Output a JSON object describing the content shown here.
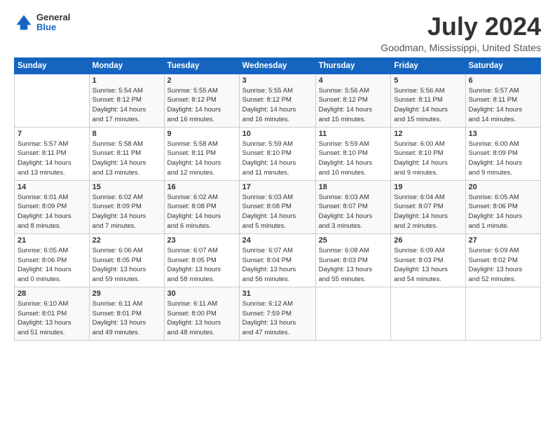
{
  "header": {
    "logo": {
      "general": "General",
      "blue": "Blue"
    },
    "title": "July 2024",
    "location": "Goodman, Mississippi, United States"
  },
  "weekdays": [
    "Sunday",
    "Monday",
    "Tuesday",
    "Wednesday",
    "Thursday",
    "Friday",
    "Saturday"
  ],
  "weeks": [
    [
      {
        "day": "",
        "info": ""
      },
      {
        "day": "1",
        "info": "Sunrise: 5:54 AM\nSunset: 8:12 PM\nDaylight: 14 hours\nand 17 minutes."
      },
      {
        "day": "2",
        "info": "Sunrise: 5:55 AM\nSunset: 8:12 PM\nDaylight: 14 hours\nand 16 minutes."
      },
      {
        "day": "3",
        "info": "Sunrise: 5:55 AM\nSunset: 8:12 PM\nDaylight: 14 hours\nand 16 minutes."
      },
      {
        "day": "4",
        "info": "Sunrise: 5:56 AM\nSunset: 8:12 PM\nDaylight: 14 hours\nand 15 minutes."
      },
      {
        "day": "5",
        "info": "Sunrise: 5:56 AM\nSunset: 8:11 PM\nDaylight: 14 hours\nand 15 minutes."
      },
      {
        "day": "6",
        "info": "Sunrise: 5:57 AM\nSunset: 8:11 PM\nDaylight: 14 hours\nand 14 minutes."
      }
    ],
    [
      {
        "day": "7",
        "info": "Sunrise: 5:57 AM\nSunset: 8:11 PM\nDaylight: 14 hours\nand 13 minutes."
      },
      {
        "day": "8",
        "info": "Sunrise: 5:58 AM\nSunset: 8:11 PM\nDaylight: 14 hours\nand 13 minutes."
      },
      {
        "day": "9",
        "info": "Sunrise: 5:58 AM\nSunset: 8:11 PM\nDaylight: 14 hours\nand 12 minutes."
      },
      {
        "day": "10",
        "info": "Sunrise: 5:59 AM\nSunset: 8:10 PM\nDaylight: 14 hours\nand 11 minutes."
      },
      {
        "day": "11",
        "info": "Sunrise: 5:59 AM\nSunset: 8:10 PM\nDaylight: 14 hours\nand 10 minutes."
      },
      {
        "day": "12",
        "info": "Sunrise: 6:00 AM\nSunset: 8:10 PM\nDaylight: 14 hours\nand 9 minutes."
      },
      {
        "day": "13",
        "info": "Sunrise: 6:00 AM\nSunset: 8:09 PM\nDaylight: 14 hours\nand 9 minutes."
      }
    ],
    [
      {
        "day": "14",
        "info": "Sunrise: 6:01 AM\nSunset: 8:09 PM\nDaylight: 14 hours\nand 8 minutes."
      },
      {
        "day": "15",
        "info": "Sunrise: 6:02 AM\nSunset: 8:09 PM\nDaylight: 14 hours\nand 7 minutes."
      },
      {
        "day": "16",
        "info": "Sunrise: 6:02 AM\nSunset: 8:08 PM\nDaylight: 14 hours\nand 6 minutes."
      },
      {
        "day": "17",
        "info": "Sunrise: 6:03 AM\nSunset: 8:08 PM\nDaylight: 14 hours\nand 5 minutes."
      },
      {
        "day": "18",
        "info": "Sunrise: 6:03 AM\nSunset: 8:07 PM\nDaylight: 14 hours\nand 3 minutes."
      },
      {
        "day": "19",
        "info": "Sunrise: 6:04 AM\nSunset: 8:07 PM\nDaylight: 14 hours\nand 2 minutes."
      },
      {
        "day": "20",
        "info": "Sunrise: 6:05 AM\nSunset: 8:06 PM\nDaylight: 14 hours\nand 1 minute."
      }
    ],
    [
      {
        "day": "21",
        "info": "Sunrise: 6:05 AM\nSunset: 8:06 PM\nDaylight: 14 hours\nand 0 minutes."
      },
      {
        "day": "22",
        "info": "Sunrise: 6:06 AM\nSunset: 8:05 PM\nDaylight: 13 hours\nand 59 minutes."
      },
      {
        "day": "23",
        "info": "Sunrise: 6:07 AM\nSunset: 8:05 PM\nDaylight: 13 hours\nand 58 minutes."
      },
      {
        "day": "24",
        "info": "Sunrise: 6:07 AM\nSunset: 8:04 PM\nDaylight: 13 hours\nand 56 minutes."
      },
      {
        "day": "25",
        "info": "Sunrise: 6:08 AM\nSunset: 8:03 PM\nDaylight: 13 hours\nand 55 minutes."
      },
      {
        "day": "26",
        "info": "Sunrise: 6:09 AM\nSunset: 8:03 PM\nDaylight: 13 hours\nand 54 minutes."
      },
      {
        "day": "27",
        "info": "Sunrise: 6:09 AM\nSunset: 8:02 PM\nDaylight: 13 hours\nand 52 minutes."
      }
    ],
    [
      {
        "day": "28",
        "info": "Sunrise: 6:10 AM\nSunset: 8:01 PM\nDaylight: 13 hours\nand 51 minutes."
      },
      {
        "day": "29",
        "info": "Sunrise: 6:11 AM\nSunset: 8:01 PM\nDaylight: 13 hours\nand 49 minutes."
      },
      {
        "day": "30",
        "info": "Sunrise: 6:11 AM\nSunset: 8:00 PM\nDaylight: 13 hours\nand 48 minutes."
      },
      {
        "day": "31",
        "info": "Sunrise: 6:12 AM\nSunset: 7:59 PM\nDaylight: 13 hours\nand 47 minutes."
      },
      {
        "day": "",
        "info": ""
      },
      {
        "day": "",
        "info": ""
      },
      {
        "day": "",
        "info": ""
      }
    ]
  ]
}
